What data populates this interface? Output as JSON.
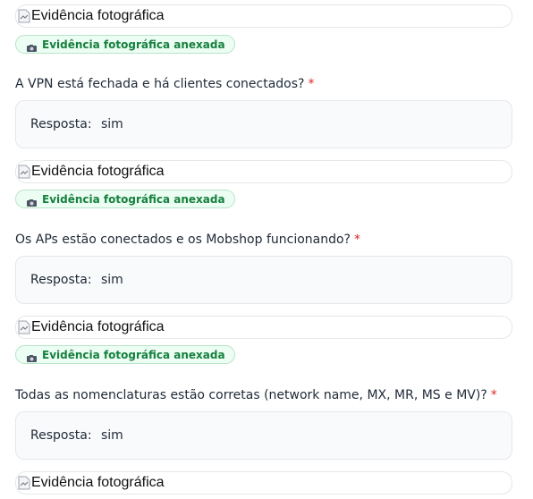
{
  "image_alt": "Evidência fotográfica",
  "badge_label": "Evidência fotográfica anexada",
  "badge_icon": "camera-icon",
  "answer_prefix": "Resposta:",
  "required_mark": "*",
  "colors": {
    "accent_green": "#15803d",
    "badge_bg": "#ecfdf3",
    "required_red": "#dc2626"
  },
  "items": [
    {
      "question": "A VPN está fechada e há clientes conectados?",
      "answer": "sim"
    },
    {
      "question": "Os APs estão conectados e os Mobshop funcionando?",
      "answer": "sim"
    },
    {
      "question": "Todas as nomenclaturas estão corretas (network name, MX, MR, MS e MV)?",
      "answer": "sim"
    }
  ]
}
